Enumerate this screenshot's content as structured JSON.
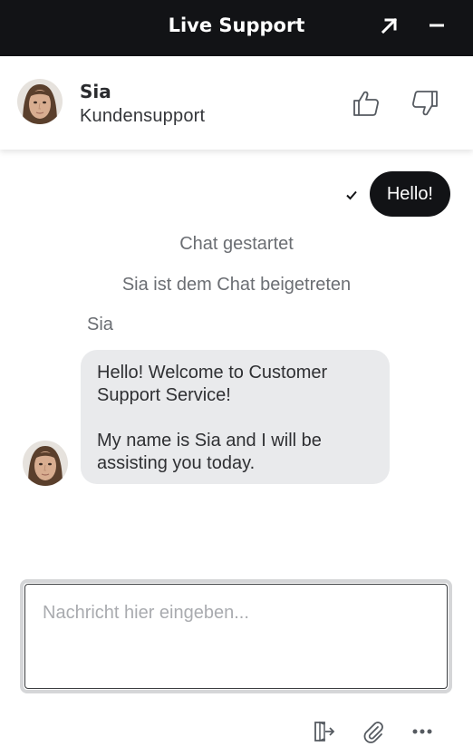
{
  "titlebar": {
    "title": "Live Support",
    "popout_icon": "arrow-up-right-icon",
    "minimize_icon": "minus-icon"
  },
  "agent": {
    "name": "Sia",
    "role": "Kundensupport",
    "avatar_icon": "agent-avatar",
    "rating_up_icon": "thumbs-up-icon",
    "rating_down_icon": "thumbs-down-icon"
  },
  "conversation": {
    "outgoing": {
      "text": "Hello!",
      "status_icon": "checkmark-icon"
    },
    "system_messages": [
      "Chat gestartet",
      "Sia ist dem Chat beigetreten"
    ],
    "incoming": {
      "sender": "Sia",
      "paragraphs": [
        "Hello! Welcome to Customer Support Service!",
        "My name is Sia and I will be assisting you today."
      ]
    }
  },
  "composer": {
    "placeholder": "Nachricht hier eingeben...",
    "value": ""
  },
  "toolbar": {
    "icons": [
      "exit-chat-icon",
      "paperclip-icon",
      "more-dots-icon"
    ]
  },
  "colors": {
    "titlebar_bg": "#121316",
    "outgoing_bubble": "#121316",
    "incoming_bubble": "#e9eaec",
    "muted_text": "#6b6e73"
  }
}
